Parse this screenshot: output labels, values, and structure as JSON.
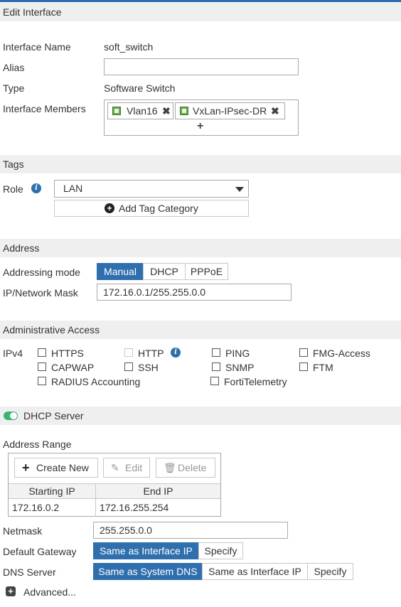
{
  "header": {
    "title": "Edit Interface"
  },
  "interface": {
    "name_label": "Interface Name",
    "name_value": "soft_switch",
    "alias_label": "Alias",
    "alias_value": "",
    "type_label": "Type",
    "type_value": "Software Switch",
    "members_label": "Interface Members",
    "members": [
      {
        "name": "Vlan16",
        "icon": "interface-port-icon"
      },
      {
        "name": "VxLan-IPsec-DR",
        "icon": "interface-port-icon"
      }
    ],
    "add_member_symbol": "+"
  },
  "tags": {
    "section_title": "Tags",
    "role_label": "Role",
    "role_value": "LAN",
    "add_tag_label": "Add Tag Category"
  },
  "address": {
    "section_title": "Address",
    "mode_label": "Addressing mode",
    "modes": [
      "Manual",
      "DHCP",
      "PPPoE"
    ],
    "mode_selected": "Manual",
    "ip_label": "IP/Network Mask",
    "ip_value": "172.16.0.1/255.255.0.0"
  },
  "admin": {
    "section_title": "Administrative Access",
    "ipv4_label": "IPv4",
    "options": [
      {
        "label": "HTTPS",
        "checked": false,
        "disabled": false
      },
      {
        "label": "HTTP",
        "checked": false,
        "disabled": true
      },
      {
        "label": "PING",
        "checked": false,
        "disabled": false
      },
      {
        "label": "FMG-Access",
        "checked": false,
        "disabled": false
      },
      {
        "label": "CAPWAP",
        "checked": false,
        "disabled": false
      },
      {
        "label": "SSH",
        "checked": false,
        "disabled": false
      },
      {
        "label": "SNMP",
        "checked": false,
        "disabled": false
      },
      {
        "label": "FTM",
        "checked": false,
        "disabled": false
      },
      {
        "label": "RADIUS Accounting",
        "checked": false,
        "disabled": false
      },
      {
        "label": "FortiTelemetry",
        "checked": false,
        "disabled": false
      }
    ]
  },
  "dhcp": {
    "section_title": "DHCP Server",
    "enabled": true,
    "range_label": "Address Range",
    "create_label": "Create New",
    "edit_label": "Edit",
    "delete_label": "Delete",
    "col_start": "Starting IP",
    "col_end": "End IP",
    "rows": [
      {
        "start": "172.16.0.2",
        "end": "172.16.255.254"
      }
    ],
    "netmask_label": "Netmask",
    "netmask_value": "255.255.0.0",
    "gateway_label": "Default Gateway",
    "gateway_options": [
      "Same as Interface IP",
      "Specify"
    ],
    "gateway_selected": "Same as Interface IP",
    "dns_label": "DNS Server",
    "dns_options": [
      "Same as System DNS",
      "Same as Interface IP",
      "Specify"
    ],
    "dns_selected": "Same as System DNS",
    "advanced_label": "Advanced..."
  },
  "colors": {
    "accent": "#2f6fad",
    "toggle_on": "#3cb371",
    "section_bg": "#efefef"
  }
}
